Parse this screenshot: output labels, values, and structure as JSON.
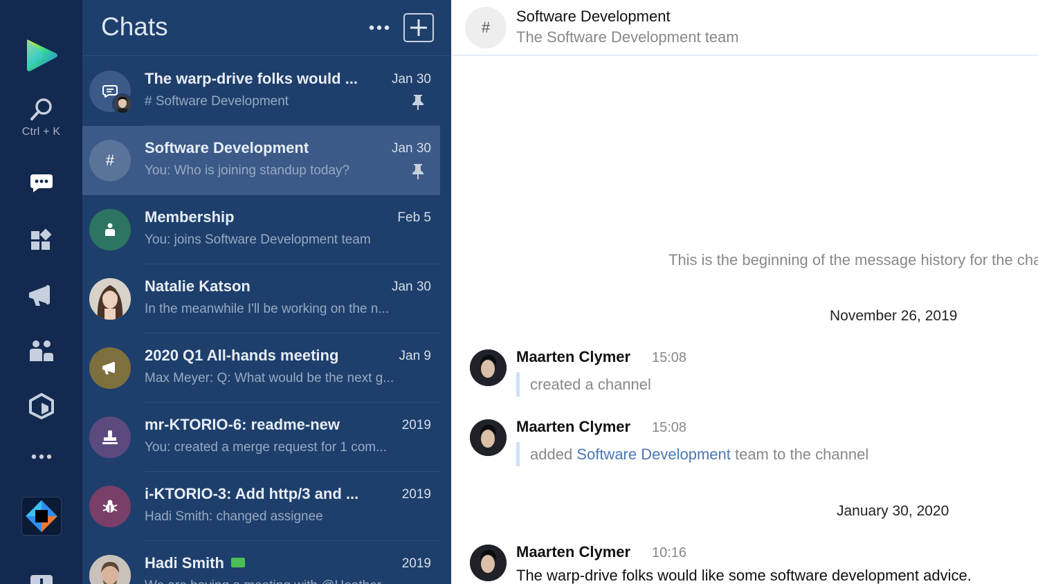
{
  "rail": {
    "search_hint": "Ctrl + K"
  },
  "chats": {
    "title": "Chats",
    "items": [
      {
        "title": "The warp-drive folks would ...",
        "date": "Jan 30",
        "preview": "# Software Development",
        "pinned": true,
        "avatar_color": "#3b5a87",
        "icon": "chat-bubble-icon",
        "selected": false
      },
      {
        "title": "Software Development",
        "date": "Jan 30",
        "preview": "You: Who is joining standup today?",
        "pinned": true,
        "avatar_color": "#5a7399",
        "icon": "#",
        "selected": true
      },
      {
        "title": "Membership",
        "date": "Feb 5",
        "preview": "You: joins Software Development team",
        "pinned": false,
        "avatar_color": "#2e7462",
        "icon": "badge-icon",
        "selected": false
      },
      {
        "title": "Natalie Katson",
        "date": "Jan 30",
        "preview": "In the meanwhile I'll be working on the n...",
        "pinned": false,
        "avatar_color": "#d7cfc5",
        "icon": "person-photo",
        "selected": false
      },
      {
        "title": "2020 Q1 All-hands meeting",
        "date": "Jan 9",
        "preview": "Max Meyer: Q: What would be the next g...",
        "pinned": false,
        "avatar_color": "#7d6f3e",
        "icon": "megaphone-icon",
        "selected": false
      },
      {
        "title": "mr-KTORIO-6: readme-new",
        "date": "2019",
        "preview": "You: created a merge request for 1 com...",
        "pinned": false,
        "avatar_color": "#5c4a7e",
        "icon": "stamp-icon",
        "selected": false
      },
      {
        "title": "i-KTORIO-3: Add http/3 and ...",
        "date": "2019",
        "preview": "Hadi Smith: changed assignee",
        "pinned": false,
        "avatar_color": "#7a3f68",
        "icon": "bug-icon",
        "selected": false
      },
      {
        "title": "Hadi Smith",
        "date": "2019",
        "preview": "We are having a meeting with @Heather...",
        "pinned": false,
        "avatar_color": "#c9c2bb",
        "icon": "person-photo",
        "selected": false
      }
    ]
  },
  "channel": {
    "title": "Software Development",
    "description": "The Software Development team",
    "avatar_symbol": "#",
    "history_start": "This is the beginning of the message history for the channel",
    "dates": [
      "November 26, 2019",
      "January 30, 2020"
    ],
    "messages": [
      {
        "author": "Maarten Clymer",
        "time": "15:08",
        "text": "created a channel"
      },
      {
        "author": "Maarten Clymer",
        "time": "15:08",
        "text_before": "added ",
        "link": "Software Development",
        "text_after": " team to the channel"
      },
      {
        "author": "Maarten Clymer",
        "time": "10:16",
        "text": "The warp-drive folks would like some software development advice."
      }
    ]
  },
  "colors": {
    "rail_bg": "#13294f",
    "chats_bg": "#1e3f6b",
    "selected_row": "#3b5a87",
    "link": "#4a78b5",
    "online": "#4bbf55"
  }
}
